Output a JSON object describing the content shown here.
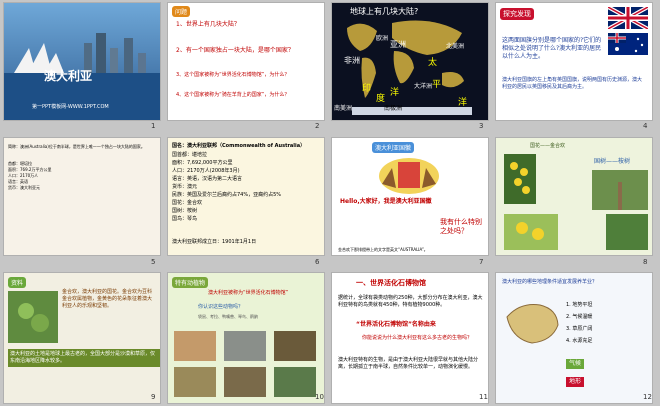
{
  "slides": [
    {
      "n": "1",
      "title": "澳大利亚",
      "subtitle": "第一PPT模板网-WWW.1PPT.COM"
    },
    {
      "n": "2",
      "badge": "问题",
      "q": [
        "1、世界上有几块大陆？",
        "2、有一个国家独占一块大陆，是哪个国家？",
        "3、这个国家被称为“世界活化石博物馆”，为什么？",
        "4、这个国家被称为“骑在羊背上的国家”，为什么？"
      ]
    },
    {
      "n": "3",
      "title": "地球上有几块大陆?",
      "labels": [
        "北美洲",
        "南美洲",
        "亚洲",
        "欧洲",
        "非洲",
        "大洋洲",
        "南极洲",
        "太",
        "平",
        "洋",
        "印",
        "度",
        "洋"
      ]
    },
    {
      "n": "4",
      "title": "探究发现",
      "q": "这两面国旗分别是哪个国家的?它们的相似之处说明了什么?澳大利亚的居民以什么人为主。",
      "a": "澳大利亚国旗的左上角有英国国旗，说明两国有历史渊源，澳大利亚的居民以英国移民及其后裔为主。"
    },
    {
      "n": "5",
      "text": [
        "简称：澳洲(Australia)位于南半球，是世界上唯一一个独占一块大陆的国家。",
        "首都：堪培拉",
        "面积：769.2万平方公里",
        "人口：2170万人",
        "语言：英语",
        "货币：澳大利亚元"
      ]
    },
    {
      "n": "6",
      "lines": [
        "国名：澳大利亚联邦（Commonwealth of Australia）",
        "国首都：堪培拉",
        "面积：7,692,000平方公里",
        "人口：2170万人(2008年3月)",
        "语言：英语，汉语为第二大语言",
        "货币：澳元",
        "民族：英国及爱尔兰后裔约占74%，亚裔约占5%",
        "国花：金合欢",
        "国树：桉树",
        "国鸟：琴鸟",
        "澳大利亚联邦成立日：1901年1月1日"
      ]
    },
    {
      "n": "7",
      "badge": "澳大利亚国徽",
      "hello": "Hello,大家好，我是澳大利亚国徽",
      "q": "我有什么特别之处吗？",
      "cap": "金合欢下那排绶带上的文字是英文“AUSTRALIA”。"
    },
    {
      "n": "8",
      "badge": "国花——金合欢",
      "label": "国树——桉树"
    },
    {
      "n": "9",
      "badge": "资料",
      "text": "金合欢，澳大利亚的国花。金合欢为豆科金合欢属植物，金黄色的花朵象征着澳大利亚人的乐观和坚韧。",
      "body": "澳大利亚的土地是地球上最古老的，全国大部分是沙漠和草原，仅东南沿海地区降水较多。"
    },
    {
      "n": "10",
      "title": "特有动植物",
      "subtitle": "澳大利亚被称为“世界活化石博物馆”",
      "q": "你认识这些动物吗？",
      "note": "袋鼠、考拉、鸭嘴兽、琴鸟、鸸鹋"
    },
    {
      "n": "11",
      "badge": "一、世界活化石博物馆",
      "text": "据统计，全球有袋类动物约250种，大部分分布在澳大利亚，澳大利亚特有的鸟类就有450种，特有植物9000种。",
      "title2": "“世界活化石博物馆”名称由来",
      "ask": "你能说说为什么澳大利亚有这么多古老的生物吗？",
      "body": "澳大利亚特有的生物，是由于澳大利亚大陆很早就与其他大陆分离，长期孤立于南半球，自然条件比较单一，动物演化缓慢。"
    },
    {
      "n": "12",
      "title": "澳大利亚的哪些地理条件适宜发展养羊业？",
      "items": [
        "1. 地势平坦",
        "2. 气候温暖",
        "3. 草原广阔",
        "4. 水源充足"
      ],
      "tag1": "气候",
      "tag2": "地形"
    }
  ]
}
